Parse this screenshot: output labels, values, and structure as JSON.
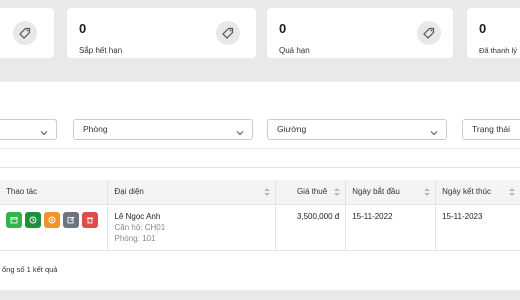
{
  "stats": [
    {
      "value": "",
      "label": "",
      "icon": "tag-icon"
    },
    {
      "value": "0",
      "label": "Sắp hết hạn",
      "icon": "tag-icon"
    },
    {
      "value": "0",
      "label": "Quá hạn",
      "icon": "tag-icon"
    },
    {
      "value": "0",
      "label": "Đã thanh lý",
      "icon": "tag-icon"
    }
  ],
  "filters": [
    {
      "placeholder": ""
    },
    {
      "placeholder": "Phòng"
    },
    {
      "placeholder": "Giường"
    },
    {
      "placeholder": "Trạng thái"
    }
  ],
  "table": {
    "headers": {
      "actions": "Thao tác",
      "representative": "Đại diện",
      "rent": "Giá thuê",
      "start": "Ngày bắt đầu",
      "end": "Ngày kết thúc"
    },
    "rows": [
      {
        "name": "Lê Ngọc Anh",
        "apartment": "Căn hộ: CH01",
        "room": "Phòng: 101",
        "rent": "3,500,000 đ",
        "start": "15-11-2022",
        "end": "15-11-2023",
        "actions": [
          {
            "icon": "calendar-icon",
            "color": "#2fb54a"
          },
          {
            "icon": "clock-icon",
            "color": "#1e8f3c"
          },
          {
            "icon": "undo-icon",
            "color": "#f0932b"
          },
          {
            "icon": "edit-icon",
            "color": "#6c757d"
          },
          {
            "icon": "trash-icon",
            "color": "#e04b4b"
          }
        ]
      }
    ]
  },
  "summary": "ổng số 1 kết quả"
}
